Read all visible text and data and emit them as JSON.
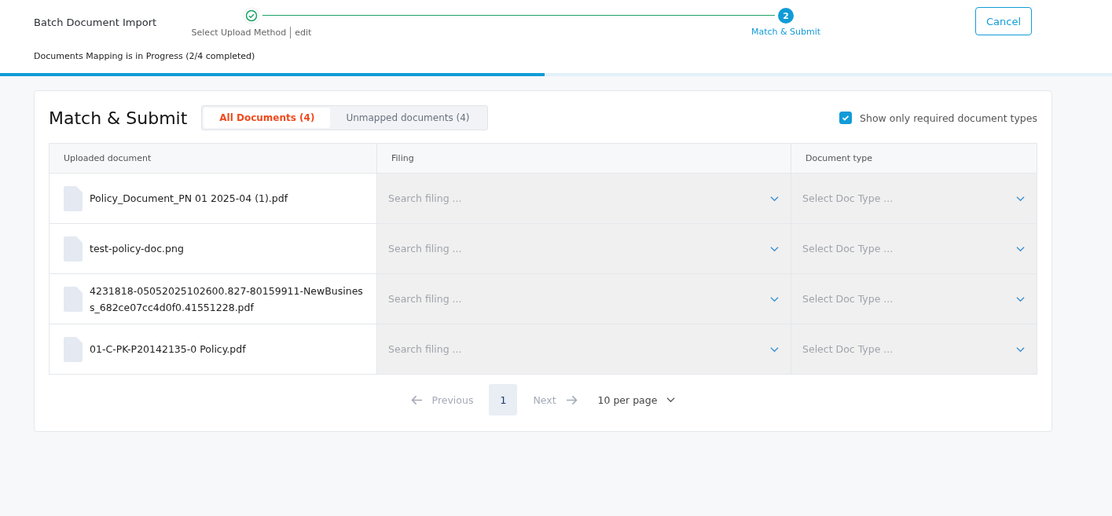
{
  "header": {
    "title": "Batch Document Import",
    "status": "Documents Mapping is in Progress (2/4 completed)",
    "cancel": "Cancel"
  },
  "steps": [
    {
      "label": "Select Upload Method",
      "edit": "edit",
      "done": true,
      "selected": false
    },
    {
      "label": "Match & Submit",
      "done": false,
      "selected": true,
      "number": "2"
    }
  ],
  "progress": {
    "level": 0.49
  },
  "panel": {
    "title": "Match & Submit",
    "tabs": [
      {
        "label": "All Documents (4)",
        "selected": true
      },
      {
        "label": "Unmapped documents (4)",
        "selected": false
      }
    ],
    "filter": {
      "label": "Show only required document types",
      "checked": true
    }
  },
  "table": {
    "columns": [
      "Uploaded document",
      "Filing",
      "Document type"
    ],
    "rows": [
      {
        "document": "Policy_Document_PN 01 2025-04 (1).pdf",
        "filing_placeholder": "Search filing ...",
        "type_placeholder": "Select Doc Type ..."
      },
      {
        "document": "test-policy-doc.png",
        "filing_placeholder": "Search filing ...",
        "type_placeholder": "Select Doc Type ..."
      },
      {
        "document": "4231818-05052025102600.827-80159911-NewBusiness_682ce07cc4d0f0.41551228.pdf",
        "filing_placeholder": "Search filing ...",
        "type_placeholder": "Select Doc Type ..."
      },
      {
        "document": "01-C-PK-P20142135-0 Policy.pdf",
        "filing_placeholder": "Search filing ...",
        "type_placeholder": "Select Doc Type ..."
      }
    ]
  },
  "pagination": {
    "previous": "Previous",
    "pages": [
      {
        "label": "1",
        "selected": true
      }
    ],
    "next": "Next",
    "per_page": "10 per page"
  }
}
